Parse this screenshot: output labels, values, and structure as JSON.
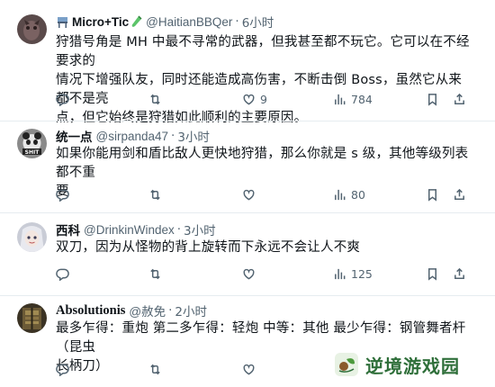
{
  "tweets": [
    {
      "name": "Micro+Tic",
      "handle": "@HaitianBBQer",
      "time": "6小时",
      "lines": [
        "狩猎号角是 MH 中最不寻常的武器，但我甚至都不玩它。它可以在不经要求的",
        "情况下增强队友，同时还能造成高伤害，不断击倒 Boss，虽然它从来都不是亮",
        "点，但它始终是狩猎如此顺利的主要原因。"
      ],
      "replies": "",
      "reposts": "",
      "likes": "9",
      "views": "784"
    },
    {
      "name": "统一点",
      "handle": "@sirpanda47",
      "time": "3小时",
      "lines": [
        "如果你能用剑和盾比敌人更快地狩猎，那么你就是 s 级，其他等级列表都不重",
        "要"
      ],
      "replies": "",
      "reposts": "",
      "likes": "",
      "views": "80"
    },
    {
      "name": "西科",
      "handle": "@DrinkinWindex",
      "time": "3小时",
      "lines": [
        "双刀，因为从怪物的背上旋转而下永远不会让人不爽"
      ],
      "replies": "",
      "reposts": "",
      "likes": "",
      "views": "125"
    },
    {
      "name": "Absolutionis",
      "handle": "@赦免",
      "time": "2小时",
      "lines": [
        "最多乍得：重炮 第二多乍得：轻炮 中等：其他 最少乍得：钢管舞者杆（昆虫",
        "长柄刀）"
      ],
      "replies": "",
      "reposts": "",
      "likes": "",
      "views": ""
    }
  ],
  "watermark": {
    "text": "逆境游戏园"
  },
  "icons": [
    "reply-icon",
    "repost-icon",
    "like-icon",
    "views-icon",
    "bookmark-icon",
    "share-icon"
  ],
  "colors": {
    "text": "#0f1419",
    "muted": "#536471",
    "divider": "#e6ecf0",
    "watermark": "#2f6f3a"
  }
}
